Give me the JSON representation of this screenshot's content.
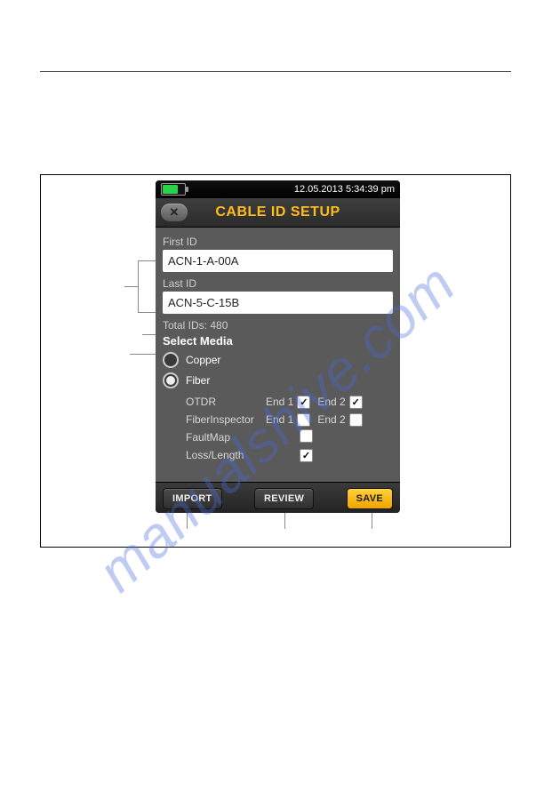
{
  "status": {
    "datetime": "12.05.2013 5:34:39 pm"
  },
  "titlebar": {
    "close_glyph": "✕",
    "title": "CABLE ID SETUP"
  },
  "form": {
    "first_id_label": "First ID",
    "first_id_value": "ACN-1-A-00A",
    "last_id_label": "Last ID",
    "last_id_value": "ACN-5-C-15B",
    "total_ids_label": "Total IDs: 480",
    "select_media_label": "Select Media",
    "media": {
      "copper": "Copper",
      "fiber": "Fiber"
    },
    "fiber_opts": {
      "otdr": "OTDR",
      "fiberinspector": "FiberInspector",
      "faultmap": "FaultMap",
      "losslength": "Loss/Length",
      "end1": "End 1",
      "end2": "End 2"
    },
    "checks": {
      "otdr_e1": "✓",
      "otdr_e2": "✓",
      "fi_e1": "",
      "fi_e2": "",
      "faultmap": "",
      "losslength": "✓"
    }
  },
  "buttons": {
    "import": "IMPORT",
    "review": "REVIEW",
    "save": "SAVE"
  },
  "watermark": "manualshive.com"
}
